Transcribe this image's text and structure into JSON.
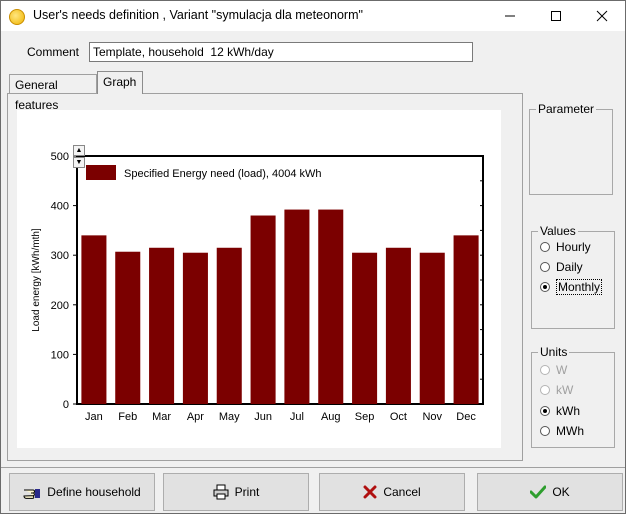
{
  "window": {
    "title": "User's needs definition , Variant  \"symulacja dla meteonorm\"",
    "minimize_glyph": "—",
    "maximize_glyph": "☐",
    "close_glyph": "✕"
  },
  "comment": {
    "label": "Comment",
    "value": "Template, household  12 kWh/day"
  },
  "tabs": [
    {
      "label": "General features",
      "active": false
    },
    {
      "label": "Graph",
      "active": true
    }
  ],
  "parameter_group": {
    "title": "Parameter"
  },
  "values_group": {
    "title": "Values",
    "options": [
      {
        "label": "Hourly",
        "selected": false
      },
      {
        "label": "Daily",
        "selected": false
      },
      {
        "label": "Monthly",
        "selected": true
      }
    ]
  },
  "units_group": {
    "title": "Units",
    "options": [
      {
        "label": "W",
        "selected": false,
        "disabled": true
      },
      {
        "label": "kW",
        "selected": false,
        "disabled": true
      },
      {
        "label": "kWh",
        "selected": true,
        "disabled": false
      },
      {
        "label": "MWh",
        "selected": false,
        "disabled": false
      }
    ]
  },
  "buttons": {
    "define_household": "Define household",
    "print": "Print",
    "cancel": "Cancel",
    "ok": "OK"
  },
  "colors": {
    "bar": "#7b0000",
    "ok_check": "#2e9e2e",
    "cancel_x": "#b01010"
  },
  "chart_data": {
    "type": "bar",
    "categories": [
      "Jan",
      "Feb",
      "Mar",
      "Apr",
      "May",
      "Jun",
      "Jul",
      "Aug",
      "Sep",
      "Oct",
      "Nov",
      "Dec"
    ],
    "series": [
      {
        "name": "Specified Energy need (load),  4004 kWh",
        "values": [
          340,
          307,
          315,
          305,
          315,
          380,
          392,
          392,
          305,
          315,
          305,
          340
        ]
      }
    ],
    "ylabel": "Load energy  [kWh/mth]",
    "xlabel": "",
    "ylim": [
      0,
      500
    ],
    "yticks": [
      0,
      100,
      200,
      300,
      400,
      500
    ],
    "legend": "top-left"
  }
}
